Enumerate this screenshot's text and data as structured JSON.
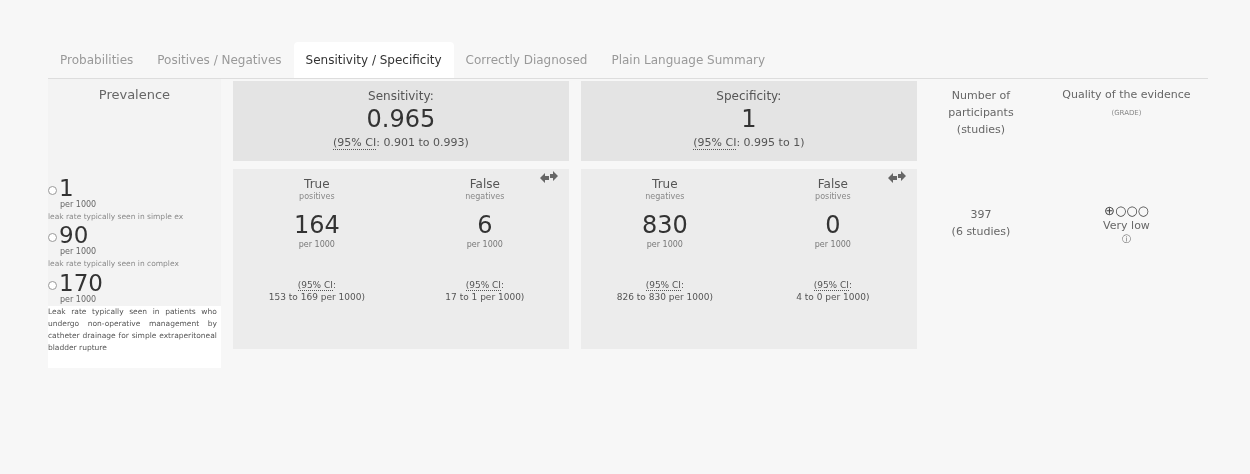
{
  "tabs": [
    {
      "label": "Probabilities",
      "selected": false
    },
    {
      "label": "Positives / Negatives",
      "selected": false
    },
    {
      "label": "Sensitivity / Specificity",
      "selected": true
    },
    {
      "label": "Correctly Diagnosed",
      "selected": false
    },
    {
      "label": "Plain Language Summary",
      "selected": false
    }
  ],
  "prevalence": {
    "heading": "Prevalence",
    "options": [
      {
        "value": "1",
        "unit": "per 1000",
        "note": "leak rate typically seen in simple ex",
        "note_faded": true,
        "selected": false
      },
      {
        "value": "90",
        "unit": "per 1000",
        "note": "leak rate typically seen in complex",
        "note_faded": true,
        "selected": false
      },
      {
        "value": "170",
        "unit": "per 1000",
        "note": "Leak rate typically seen in patients who undergo non-operative management by catheter drainage for simple extraperitoneal bladder rupture",
        "note_faded": false,
        "selected": false
      }
    ]
  },
  "panels": [
    {
      "label": "Sensitivity:",
      "value": "0.965",
      "ci_label": "(95% CI",
      "ci_rest": ": 0.901 to 0.993)",
      "cells": [
        {
          "title": "True",
          "subtitle": "positives",
          "value": "164",
          "unit": "per 1000",
          "ci_label": "(95% CI",
          "ci_rest": ":",
          "ci_range": "153 to 169 per 1000)"
        },
        {
          "title": "False",
          "subtitle": "negatives",
          "value": "6",
          "unit": "per 1000",
          "ci_label": "(95% CI",
          "ci_rest": ":",
          "ci_range": "17 to 1 per 1000)"
        }
      ]
    },
    {
      "label": "Specificity:",
      "value": "1",
      "ci_label": "(95% CI",
      "ci_rest": ": 0.995 to 1)",
      "cells": [
        {
          "title": "True",
          "subtitle": "negatives",
          "value": "830",
          "unit": "per 1000",
          "ci_label": "(95% CI",
          "ci_rest": ":",
          "ci_range": "826 to 830 per 1000)"
        },
        {
          "title": "False",
          "subtitle": "positives",
          "value": "0",
          "unit": "per 1000",
          "ci_label": "(95% CI",
          "ci_rest": ":",
          "ci_range": "4 to 0 per 1000)"
        }
      ]
    }
  ],
  "participants": {
    "heading": "Number of participants (studies)",
    "count": "397",
    "studies": "(6 studies)"
  },
  "quality": {
    "heading": "Quality of the evidence",
    "subheading": "(GRADE)",
    "symbols": "⊕○○○",
    "rating": "Very low",
    "info": "ⓘ"
  }
}
